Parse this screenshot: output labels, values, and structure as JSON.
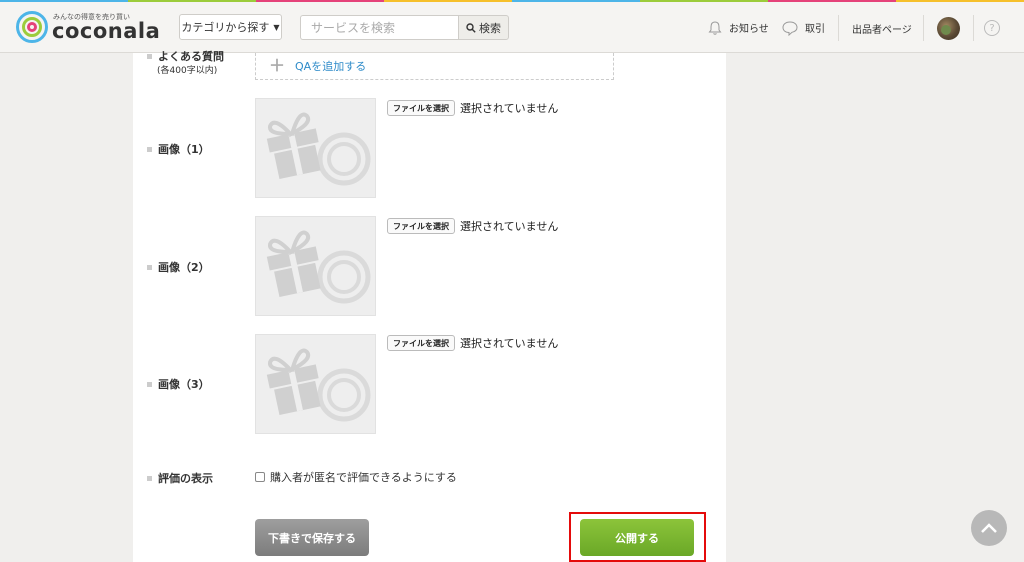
{
  "brand": {
    "tagline": "みんなの得意を売り買い",
    "name": "coconala",
    "strip_colors": [
      "#4db5e8",
      "#9ccc3c",
      "#e5427a",
      "#f6c02c",
      "#4db5e8",
      "#9ccc3c",
      "#e5427a",
      "#f6c02c"
    ]
  },
  "header": {
    "category_button": "カテゴリから探す",
    "search_placeholder": "サービスを検索",
    "search_button": "検索",
    "nav_notice": "お知らせ",
    "nav_deal": "取引",
    "nav_seller": "出品者ページ",
    "help": "?"
  },
  "form": {
    "faq_label": "よくある質問",
    "faq_sub": "(各400字以内)",
    "qa_add": "QAを追加する",
    "images": [
      {
        "label": "画像（1）",
        "file_button": "ファイルを選択",
        "status": "選択されていません"
      },
      {
        "label": "画像（2）",
        "file_button": "ファイルを選択",
        "status": "選択されていません"
      },
      {
        "label": "画像（3）",
        "file_button": "ファイルを選択",
        "status": "選択されていません"
      }
    ],
    "review_label": "評価の表示",
    "review_checkbox": "購入者が匿名で評価できるようにする",
    "draft_button": "下書きで保存する",
    "publish_button": "公開する"
  },
  "colors": {
    "accent_green": "#7ab631",
    "link_blue": "#2e8bc9",
    "highlight_red": "#e40b0b"
  }
}
